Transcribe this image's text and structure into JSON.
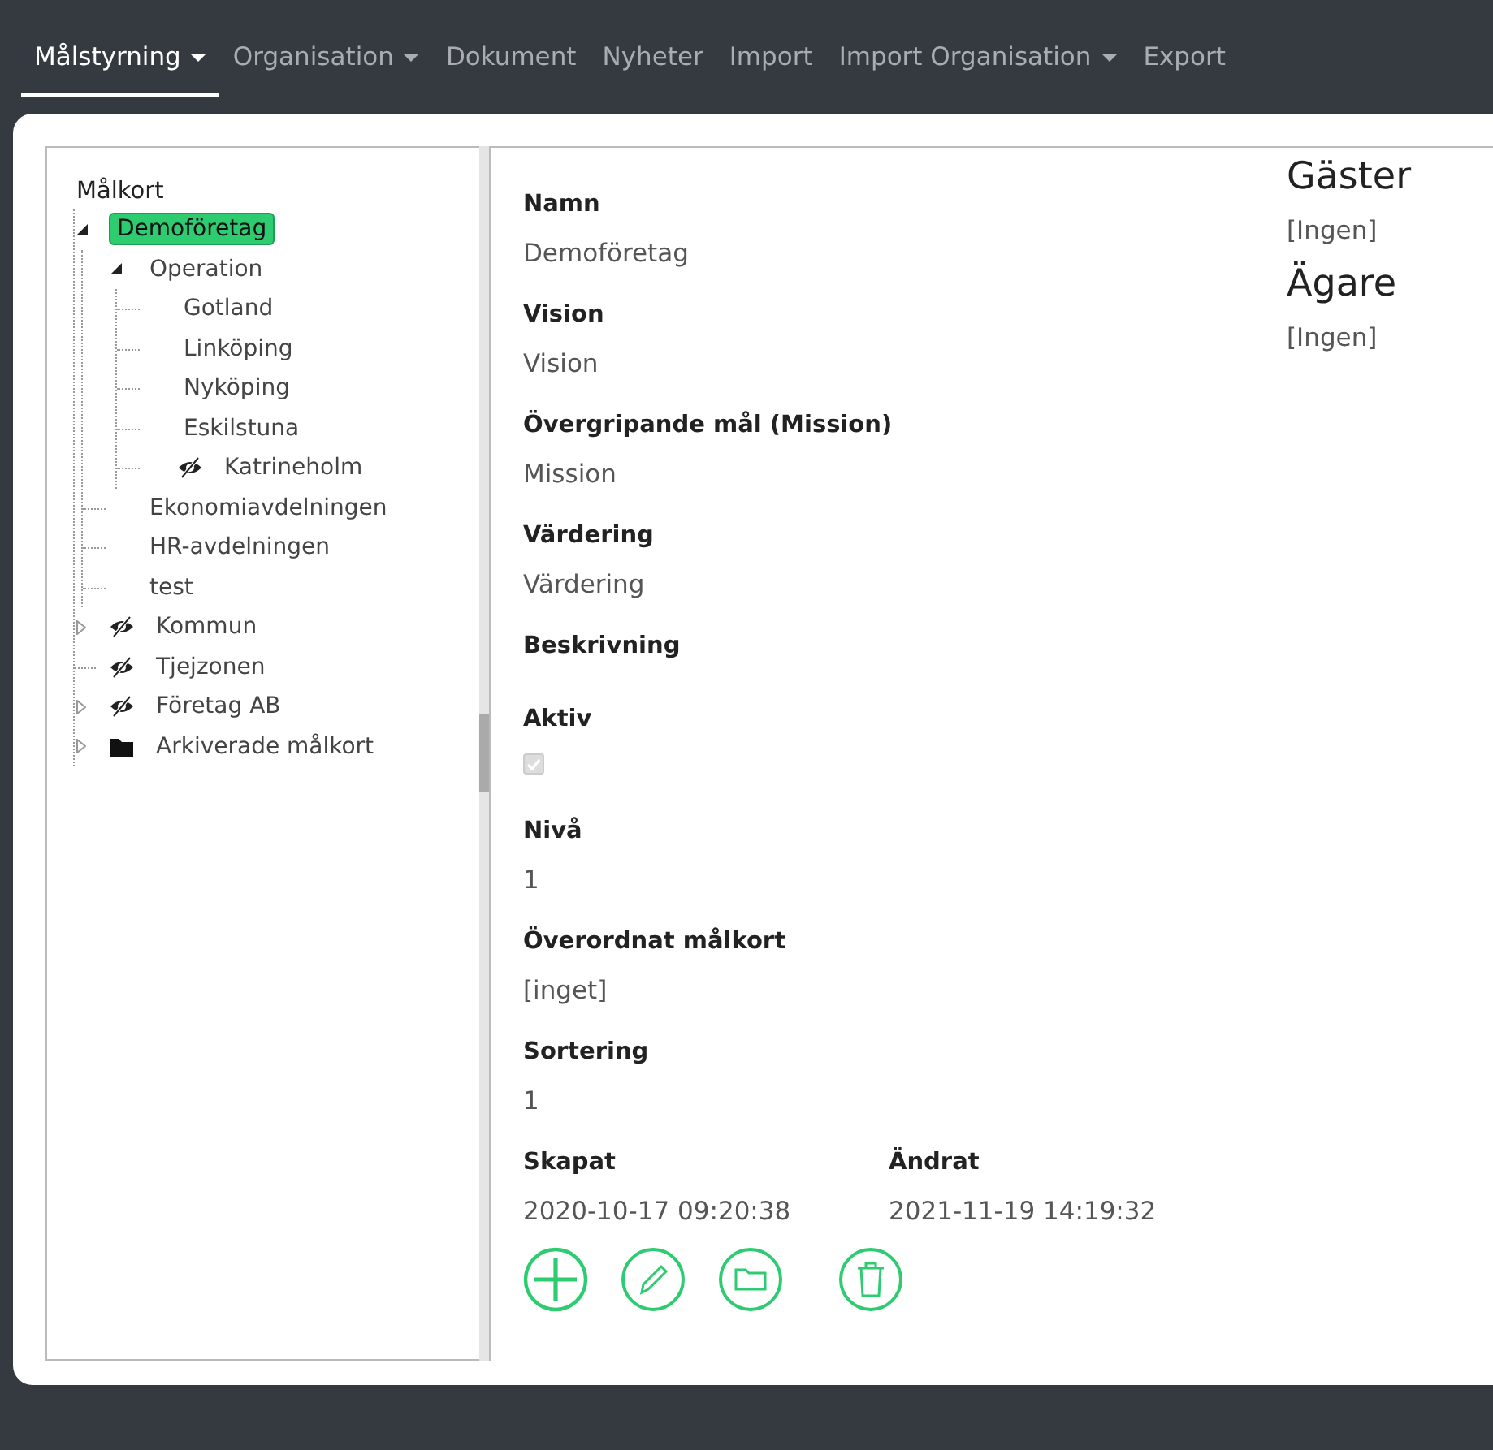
{
  "nav": {
    "items": [
      {
        "label": "Målstyrning",
        "dropdown": true,
        "selected": true
      },
      {
        "label": "Organisation",
        "dropdown": true,
        "selected": false
      },
      {
        "label": "Dokument",
        "dropdown": false,
        "selected": false
      },
      {
        "label": "Nyheter",
        "dropdown": false,
        "selected": false
      },
      {
        "label": "Import",
        "dropdown": false,
        "selected": false
      },
      {
        "label": "Import Organisation",
        "dropdown": true,
        "selected": false
      },
      {
        "label": "Export",
        "dropdown": false,
        "selected": false
      }
    ]
  },
  "tree": {
    "root": "Målkort",
    "items": [
      {
        "label": "Demoföretag",
        "selected": true,
        "expanded": true,
        "children": [
          {
            "label": "Operation",
            "selected": false,
            "expanded": true,
            "children": [
              {
                "label": "Gotland",
                "selected": false
              },
              {
                "label": "Linköping",
                "selected": false
              },
              {
                "label": "Nyköping",
                "selected": false
              },
              {
                "label": "Eskilstuna",
                "selected": false
              },
              {
                "label": "Katrineholm",
                "kind": "eye",
                "selected": false
              }
            ]
          },
          {
            "label": "Ekonomiavdelningen",
            "selected": false
          },
          {
            "label": "HR-avdelningen",
            "selected": false
          },
          {
            "label": "test",
            "selected": false
          }
        ]
      },
      {
        "label": "Kommun",
        "kind": "eye",
        "selected": false,
        "expanded": false
      },
      {
        "label": "Tjejzonen",
        "kind": "eye",
        "selected": false
      },
      {
        "label": "Företag AB",
        "kind": "eye",
        "selected": false,
        "expanded": false
      },
      {
        "label": "Arkiverade målkort",
        "kind": "folder",
        "selected": false,
        "expanded": false
      }
    ]
  },
  "details": {
    "fields": [
      {
        "kind": "text",
        "label": "Namn",
        "value": "Demoföretag"
      },
      {
        "kind": "text",
        "label": "Vision",
        "value": "Vision"
      },
      {
        "kind": "text",
        "label": "Övergripande mål (Mission)",
        "value": "Mission"
      },
      {
        "kind": "text",
        "label": "Värdering",
        "value": "Värdering"
      },
      {
        "kind": "text",
        "label": "Beskrivning"
      },
      {
        "kind": "checkbox",
        "label": "Aktiv",
        "checked": true,
        "disabled": true
      },
      {
        "kind": "text",
        "label": "Nivå",
        "value": "1"
      },
      {
        "kind": "text",
        "label": "Överordnat målkort",
        "value": "[inget]"
      },
      {
        "kind": "text",
        "label": "Sortering",
        "value": "1"
      }
    ],
    "dates": [
      {
        "label": "Skapat",
        "value": "2020-10-17 09:20:38"
      },
      {
        "label": "Ändrat",
        "value": "2021-11-19 14:19:32"
      }
    ],
    "actions": [
      {
        "kind": "add"
      },
      {
        "kind": "edit"
      },
      {
        "kind": "folder"
      },
      {
        "kind": "delete"
      }
    ]
  },
  "side": [
    {
      "heading": "Gäster",
      "value": "[Ingen]"
    },
    {
      "heading": "Ägare",
      "value": "[Ingen]"
    }
  ]
}
